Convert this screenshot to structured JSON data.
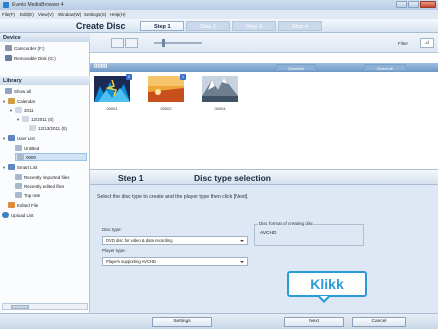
{
  "window": {
    "title": "Everio MediaBrowser 4"
  },
  "menu": [
    "File(F)",
    "Edit(E)",
    "View(V)",
    "Window(W)",
    "Settings(S)",
    "Help(H)"
  ],
  "header": {
    "title": "Create Disc",
    "steps": [
      {
        "label": "Step 1",
        "active": true
      },
      {
        "label": "Step 2",
        "active": false
      },
      {
        "label": "Step 3",
        "active": false
      },
      {
        "label": "Step 4",
        "active": false
      }
    ]
  },
  "toolbar": {
    "filter_label": "Filter"
  },
  "sidebar": {
    "device_heading": "Device",
    "devices": [
      "Camcorder (F:)",
      "Removable Disk (G:)"
    ],
    "library_heading": "Library",
    "show_all": "Show all",
    "calendar": "Calendar",
    "year": "2011",
    "month": "12/2011 (0)",
    "day": "12/13/2011 (0)",
    "user_list": "User List",
    "untitled": "Untitled",
    "selected_item": "0000",
    "smart_list": "Smart List",
    "recently_imported": "Recently imported files",
    "recently_edited": "Recently edited files",
    "top_rate": "Top rate",
    "edited_file": "Edited File",
    "upload_list": "Upload List"
  },
  "group": {
    "name": "0000",
    "deselect": "Deselect",
    "select_all": "Select all"
  },
  "thumbnails": [
    {
      "caption": "00001",
      "badge": "1"
    },
    {
      "caption": "00002",
      "badge": "1"
    },
    {
      "caption": "00004",
      "badge": ""
    }
  ],
  "step_panel": {
    "step": "Step 1",
    "heading": "Disc type selection",
    "instruction": "Select the disc type to create and the player type then click [Next].",
    "disc_type_label": "Disc type:",
    "disc_type_value": "DVD disc for video & data recording",
    "player_type_label": "Player type:",
    "player_type_value": "Players supporting AVCHD",
    "format_label": "Disc format of creating disc",
    "format_value": "AVCHD"
  },
  "callout": {
    "text": "Klikk"
  },
  "footer": {
    "settings": "Settings",
    "next": "Next",
    "cancel": "Cancel"
  },
  "colors": {
    "accent": "#2a9bd6",
    "group_bar": "#7ea3cc"
  }
}
